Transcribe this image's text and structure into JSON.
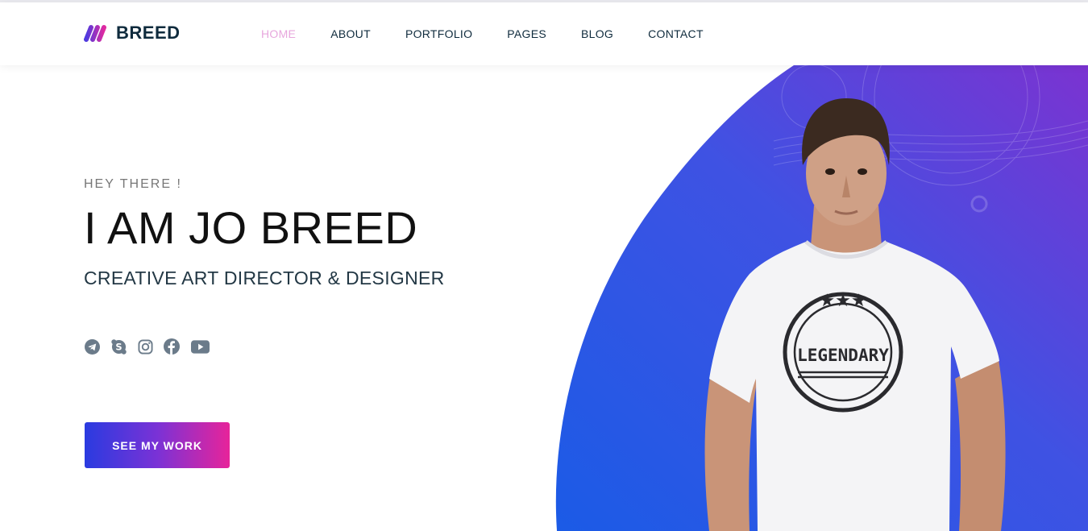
{
  "brand": {
    "name": "BREED",
    "icon": "logo-mark-icon",
    "text_color": "#0f2b3d"
  },
  "nav": {
    "items": [
      {
        "label": "HOME",
        "active": true
      },
      {
        "label": "ABOUT",
        "active": false
      },
      {
        "label": "PORTFOLIO",
        "active": false
      },
      {
        "label": "PAGES",
        "active": false
      },
      {
        "label": "BLOG",
        "active": false
      },
      {
        "label": "CONTACT",
        "active": false
      }
    ],
    "active_color": "#e7a7dd"
  },
  "hero": {
    "eyebrow": "HEY THERE !",
    "title": "I AM JO BREED",
    "subtitle": "CREATIVE ART DIRECTOR & DESIGNER",
    "socials": [
      {
        "icon": "telegram-icon"
      },
      {
        "icon": "skype-icon"
      },
      {
        "icon": "instagram-icon"
      },
      {
        "icon": "facebook-icon"
      },
      {
        "icon": "youtube-icon"
      }
    ],
    "cta_label": "SEE MY WORK",
    "shirt_text": "LEGENDARY",
    "colors": {
      "blue": "#1b5be6",
      "purple": "#7b3cd6",
      "pink": "#e7249a",
      "icon_gray": "#6b7b8a"
    }
  }
}
